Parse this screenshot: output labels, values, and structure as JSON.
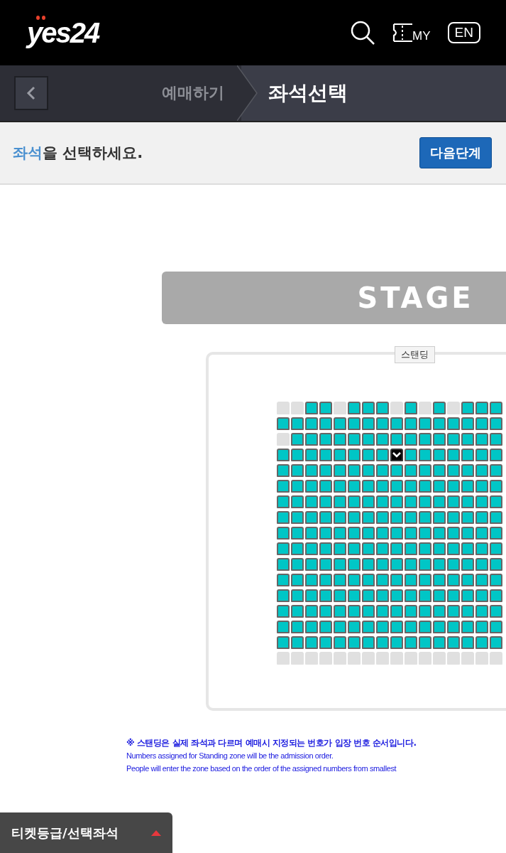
{
  "header": {
    "logo": "yes24",
    "my_label": "MY",
    "language_button": "EN"
  },
  "breadcrumb": [
    {
      "label": "예매하기",
      "selected": false
    },
    {
      "label": "좌석선택",
      "selected": true
    }
  ],
  "instruction": {
    "highlight": "좌석",
    "text": "을 선택하세요.",
    "next_button": "다음단계"
  },
  "stage": {
    "label": "STAGE"
  },
  "zone": {
    "label": "스탠딩"
  },
  "seat_rows": [
    {
      "seats": [
        {
          "available": false,
          "selected": false
        },
        {
          "available": false,
          "selected": false
        },
        {
          "available": true,
          "selected": false
        },
        {
          "available": true,
          "selected": false
        },
        {
          "available": false,
          "selected": false
        },
        {
          "available": true,
          "selected": false
        },
        {
          "available": true,
          "selected": false
        },
        {
          "available": true,
          "selected": false
        },
        {
          "available": false,
          "selected": false
        },
        {
          "available": true,
          "selected": false
        },
        {
          "available": false,
          "selected": false
        },
        {
          "available": true,
          "selected": false
        },
        {
          "available": false,
          "selected": false
        },
        {
          "available": true,
          "selected": false
        },
        {
          "available": true,
          "selected": false
        },
        {
          "available": true,
          "selected": false
        }
      ]
    },
    {
      "seats": [
        {
          "available": true,
          "selected": false
        },
        {
          "available": true,
          "selected": false
        },
        {
          "available": true,
          "selected": false
        },
        {
          "available": true,
          "selected": false
        },
        {
          "available": true,
          "selected": false
        },
        {
          "available": true,
          "selected": false
        },
        {
          "available": true,
          "selected": false
        },
        {
          "available": true,
          "selected": false
        },
        {
          "available": true,
          "selected": false
        },
        {
          "available": true,
          "selected": false
        },
        {
          "available": true,
          "selected": false
        },
        {
          "available": true,
          "selected": false
        },
        {
          "available": true,
          "selected": false
        },
        {
          "available": true,
          "selected": false
        },
        {
          "available": true,
          "selected": false
        },
        {
          "available": true,
          "selected": false
        }
      ]
    },
    {
      "seats": [
        {
          "available": false,
          "selected": false
        },
        {
          "available": true,
          "selected": false
        },
        {
          "available": true,
          "selected": false
        },
        {
          "available": true,
          "selected": false
        },
        {
          "available": true,
          "selected": false
        },
        {
          "available": true,
          "selected": false
        },
        {
          "available": true,
          "selected": false
        },
        {
          "available": true,
          "selected": false
        },
        {
          "available": true,
          "selected": false
        },
        {
          "available": true,
          "selected": false
        },
        {
          "available": true,
          "selected": false
        },
        {
          "available": true,
          "selected": false
        },
        {
          "available": true,
          "selected": false
        },
        {
          "available": true,
          "selected": false
        },
        {
          "available": true,
          "selected": false
        },
        {
          "available": true,
          "selected": false
        }
      ]
    },
    {
      "seats": [
        {
          "available": true,
          "selected": false
        },
        {
          "available": true,
          "selected": false
        },
        {
          "available": true,
          "selected": false
        },
        {
          "available": true,
          "selected": false
        },
        {
          "available": true,
          "selected": false
        },
        {
          "available": true,
          "selected": false
        },
        {
          "available": true,
          "selected": false
        },
        {
          "available": true,
          "selected": false
        },
        {
          "available": true,
          "selected": true
        },
        {
          "available": true,
          "selected": false
        },
        {
          "available": true,
          "selected": false
        },
        {
          "available": true,
          "selected": false
        },
        {
          "available": true,
          "selected": false
        },
        {
          "available": true,
          "selected": false
        },
        {
          "available": true,
          "selected": false
        },
        {
          "available": true,
          "selected": false
        }
      ]
    },
    {
      "seats": [
        {
          "available": true,
          "selected": false
        },
        {
          "available": true,
          "selected": false
        },
        {
          "available": true,
          "selected": false
        },
        {
          "available": true,
          "selected": false
        },
        {
          "available": true,
          "selected": false
        },
        {
          "available": true,
          "selected": false
        },
        {
          "available": true,
          "selected": false
        },
        {
          "available": true,
          "selected": false
        },
        {
          "available": true,
          "selected": false
        },
        {
          "available": true,
          "selected": false
        },
        {
          "available": true,
          "selected": false
        },
        {
          "available": true,
          "selected": false
        },
        {
          "available": true,
          "selected": false
        },
        {
          "available": true,
          "selected": false
        },
        {
          "available": true,
          "selected": false
        },
        {
          "available": true,
          "selected": false
        }
      ]
    },
    {
      "seats": [
        {
          "available": true,
          "selected": false
        },
        {
          "available": true,
          "selected": false
        },
        {
          "available": true,
          "selected": false
        },
        {
          "available": true,
          "selected": false
        },
        {
          "available": true,
          "selected": false
        },
        {
          "available": true,
          "selected": false
        },
        {
          "available": true,
          "selected": false
        },
        {
          "available": true,
          "selected": false
        },
        {
          "available": true,
          "selected": false
        },
        {
          "available": true,
          "selected": false
        },
        {
          "available": true,
          "selected": false
        },
        {
          "available": true,
          "selected": false
        },
        {
          "available": true,
          "selected": false
        },
        {
          "available": true,
          "selected": false
        },
        {
          "available": true,
          "selected": false
        },
        {
          "available": true,
          "selected": false
        }
      ]
    },
    {
      "seats": [
        {
          "available": true,
          "selected": false
        },
        {
          "available": true,
          "selected": false
        },
        {
          "available": true,
          "selected": false
        },
        {
          "available": true,
          "selected": false
        },
        {
          "available": true,
          "selected": false
        },
        {
          "available": true,
          "selected": false
        },
        {
          "available": true,
          "selected": false
        },
        {
          "available": true,
          "selected": false
        },
        {
          "available": true,
          "selected": false
        },
        {
          "available": true,
          "selected": false
        },
        {
          "available": true,
          "selected": false
        },
        {
          "available": true,
          "selected": false
        },
        {
          "available": true,
          "selected": false
        },
        {
          "available": true,
          "selected": false
        },
        {
          "available": true,
          "selected": false
        },
        {
          "available": true,
          "selected": false
        }
      ]
    },
    {
      "seats": [
        {
          "available": true,
          "selected": false
        },
        {
          "available": true,
          "selected": false
        },
        {
          "available": true,
          "selected": false
        },
        {
          "available": true,
          "selected": false
        },
        {
          "available": true,
          "selected": false
        },
        {
          "available": true,
          "selected": false
        },
        {
          "available": true,
          "selected": false
        },
        {
          "available": true,
          "selected": false
        },
        {
          "available": true,
          "selected": false
        },
        {
          "available": true,
          "selected": false
        },
        {
          "available": true,
          "selected": false
        },
        {
          "available": true,
          "selected": false
        },
        {
          "available": true,
          "selected": false
        },
        {
          "available": true,
          "selected": false
        },
        {
          "available": true,
          "selected": false
        },
        {
          "available": true,
          "selected": false
        }
      ]
    },
    {
      "seats": [
        {
          "available": true,
          "selected": false
        },
        {
          "available": true,
          "selected": false
        },
        {
          "available": true,
          "selected": false
        },
        {
          "available": true,
          "selected": false
        },
        {
          "available": true,
          "selected": false
        },
        {
          "available": true,
          "selected": false
        },
        {
          "available": true,
          "selected": false
        },
        {
          "available": true,
          "selected": false
        },
        {
          "available": true,
          "selected": false
        },
        {
          "available": true,
          "selected": false
        },
        {
          "available": true,
          "selected": false
        },
        {
          "available": true,
          "selected": false
        },
        {
          "available": true,
          "selected": false
        },
        {
          "available": true,
          "selected": false
        },
        {
          "available": true,
          "selected": false
        },
        {
          "available": true,
          "selected": false
        }
      ]
    },
    {
      "seats": [
        {
          "available": true,
          "selected": false
        },
        {
          "available": true,
          "selected": false
        },
        {
          "available": true,
          "selected": false
        },
        {
          "available": true,
          "selected": false
        },
        {
          "available": true,
          "selected": false
        },
        {
          "available": true,
          "selected": false
        },
        {
          "available": true,
          "selected": false
        },
        {
          "available": true,
          "selected": false
        },
        {
          "available": true,
          "selected": false
        },
        {
          "available": true,
          "selected": false
        },
        {
          "available": true,
          "selected": false
        },
        {
          "available": true,
          "selected": false
        },
        {
          "available": true,
          "selected": false
        },
        {
          "available": true,
          "selected": false
        },
        {
          "available": true,
          "selected": false
        },
        {
          "available": true,
          "selected": false
        }
      ]
    },
    {
      "seats": [
        {
          "available": true,
          "selected": false
        },
        {
          "available": true,
          "selected": false
        },
        {
          "available": true,
          "selected": false
        },
        {
          "available": true,
          "selected": false
        },
        {
          "available": true,
          "selected": false
        },
        {
          "available": true,
          "selected": false
        },
        {
          "available": true,
          "selected": false
        },
        {
          "available": true,
          "selected": false
        },
        {
          "available": true,
          "selected": false
        },
        {
          "available": true,
          "selected": false
        },
        {
          "available": true,
          "selected": false
        },
        {
          "available": true,
          "selected": false
        },
        {
          "available": true,
          "selected": false
        },
        {
          "available": true,
          "selected": false
        },
        {
          "available": true,
          "selected": false
        },
        {
          "available": true,
          "selected": false
        }
      ]
    },
    {
      "seats": [
        {
          "available": true,
          "selected": false
        },
        {
          "available": true,
          "selected": false
        },
        {
          "available": true,
          "selected": false
        },
        {
          "available": true,
          "selected": false
        },
        {
          "available": true,
          "selected": false
        },
        {
          "available": true,
          "selected": false
        },
        {
          "available": true,
          "selected": false
        },
        {
          "available": true,
          "selected": false
        },
        {
          "available": true,
          "selected": false
        },
        {
          "available": true,
          "selected": false
        },
        {
          "available": true,
          "selected": false
        },
        {
          "available": true,
          "selected": false
        },
        {
          "available": true,
          "selected": false
        },
        {
          "available": true,
          "selected": false
        },
        {
          "available": true,
          "selected": false
        },
        {
          "available": true,
          "selected": false
        }
      ]
    },
    {
      "seats": [
        {
          "available": true,
          "selected": false
        },
        {
          "available": true,
          "selected": false
        },
        {
          "available": true,
          "selected": false
        },
        {
          "available": true,
          "selected": false
        },
        {
          "available": true,
          "selected": false
        },
        {
          "available": true,
          "selected": false
        },
        {
          "available": true,
          "selected": false
        },
        {
          "available": true,
          "selected": false
        },
        {
          "available": true,
          "selected": false
        },
        {
          "available": true,
          "selected": false
        },
        {
          "available": true,
          "selected": false
        },
        {
          "available": true,
          "selected": false
        },
        {
          "available": true,
          "selected": false
        },
        {
          "available": true,
          "selected": false
        },
        {
          "available": true,
          "selected": false
        },
        {
          "available": true,
          "selected": false
        }
      ]
    },
    {
      "seats": [
        {
          "available": true,
          "selected": false
        },
        {
          "available": true,
          "selected": false
        },
        {
          "available": true,
          "selected": false
        },
        {
          "available": true,
          "selected": false
        },
        {
          "available": true,
          "selected": false
        },
        {
          "available": true,
          "selected": false
        },
        {
          "available": true,
          "selected": false
        },
        {
          "available": true,
          "selected": false
        },
        {
          "available": true,
          "selected": false
        },
        {
          "available": true,
          "selected": false
        },
        {
          "available": true,
          "selected": false
        },
        {
          "available": true,
          "selected": false
        },
        {
          "available": true,
          "selected": false
        },
        {
          "available": true,
          "selected": false
        },
        {
          "available": true,
          "selected": false
        },
        {
          "available": true,
          "selected": false
        }
      ]
    },
    {
      "seats": [
        {
          "available": true,
          "selected": false
        },
        {
          "available": true,
          "selected": false
        },
        {
          "available": true,
          "selected": false
        },
        {
          "available": true,
          "selected": false
        },
        {
          "available": true,
          "selected": false
        },
        {
          "available": true,
          "selected": false
        },
        {
          "available": true,
          "selected": false
        },
        {
          "available": true,
          "selected": false
        },
        {
          "available": true,
          "selected": false
        },
        {
          "available": true,
          "selected": false
        },
        {
          "available": true,
          "selected": false
        },
        {
          "available": true,
          "selected": false
        },
        {
          "available": true,
          "selected": false
        },
        {
          "available": true,
          "selected": false
        },
        {
          "available": true,
          "selected": false
        },
        {
          "available": true,
          "selected": false
        }
      ]
    },
    {
      "seats": [
        {
          "available": true,
          "selected": false
        },
        {
          "available": true,
          "selected": false
        },
        {
          "available": true,
          "selected": false
        },
        {
          "available": true,
          "selected": false
        },
        {
          "available": true,
          "selected": false
        },
        {
          "available": true,
          "selected": false
        },
        {
          "available": true,
          "selected": false
        },
        {
          "available": true,
          "selected": false
        },
        {
          "available": true,
          "selected": false
        },
        {
          "available": true,
          "selected": false
        },
        {
          "available": true,
          "selected": false
        },
        {
          "available": true,
          "selected": false
        },
        {
          "available": true,
          "selected": false
        },
        {
          "available": true,
          "selected": false
        },
        {
          "available": true,
          "selected": false
        },
        {
          "available": true,
          "selected": false
        }
      ]
    },
    {
      "seats": [
        {
          "available": false,
          "selected": false
        },
        {
          "available": false,
          "selected": false
        },
        {
          "available": false,
          "selected": false
        },
        {
          "available": false,
          "selected": false
        },
        {
          "available": false,
          "selected": false
        },
        {
          "available": false,
          "selected": false
        },
        {
          "available": false,
          "selected": false
        },
        {
          "available": false,
          "selected": false
        },
        {
          "available": false,
          "selected": false
        },
        {
          "available": false,
          "selected": false
        },
        {
          "available": false,
          "selected": false
        },
        {
          "available": false,
          "selected": false
        },
        {
          "available": false,
          "selected": false
        },
        {
          "available": false,
          "selected": false
        },
        {
          "available": false,
          "selected": false
        },
        {
          "available": false,
          "selected": false
        }
      ]
    }
  ],
  "notes": [
    "※ 스탠딩은 실제 좌석과 다르며 예매시 지정되는 번호가 입장 번호 순서입니다.",
    "Numbers assigned for Standing zone will be the admission order.",
    "People will enter the zone based on the order of the assigned numbers from smallest"
  ],
  "bottom_tab": {
    "label": "티켓등급/선택좌석",
    "expanded": false
  }
}
